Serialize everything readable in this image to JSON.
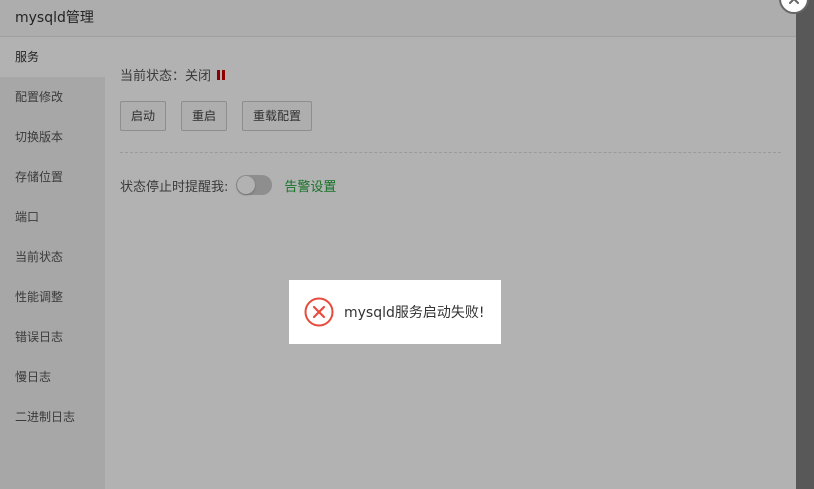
{
  "window": {
    "title": "mysqld管理"
  },
  "sidebar": {
    "items": [
      {
        "label": "服务"
      },
      {
        "label": "配置修改"
      },
      {
        "label": "切换版本"
      },
      {
        "label": "存储位置"
      },
      {
        "label": "端口"
      },
      {
        "label": "当前状态"
      },
      {
        "label": "性能调整"
      },
      {
        "label": "错误日志"
      },
      {
        "label": "慢日志"
      },
      {
        "label": "二进制日志"
      }
    ],
    "active_index": 0
  },
  "service": {
    "status_label": "当前状态：",
    "status_value": "关闭",
    "buttons": {
      "start": "启动",
      "restart": "重启",
      "reload": "重载配置"
    },
    "alert_label": "状态停止时提醒我:",
    "alert_toggle_on": false,
    "alert_link": "告警设置"
  },
  "toast": {
    "message": "mysqld服务启动失败!"
  },
  "colors": {
    "accent_green": "#20a53a",
    "status_red": "#cc0000",
    "error_red": "#e64b3c"
  }
}
